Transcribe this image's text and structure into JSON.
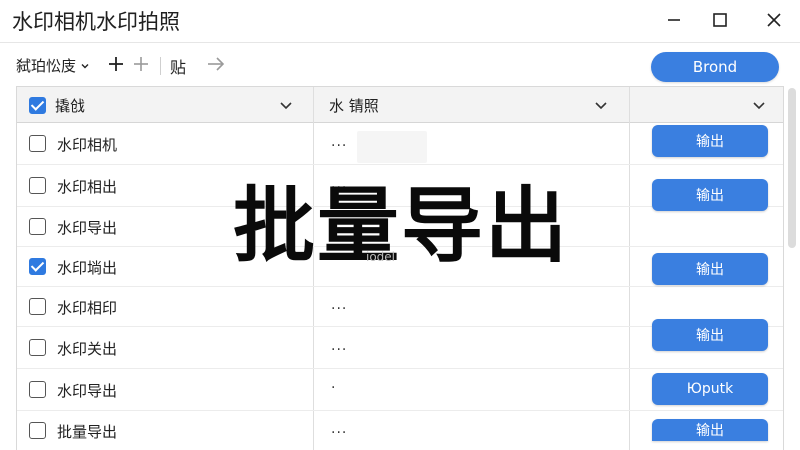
{
  "window": {
    "title": "水印相机水印拍照"
  },
  "toolbar": {
    "view_label": "弑珀忪庋",
    "paste_label": "贴",
    "brand_button": "Brond"
  },
  "table": {
    "header": {
      "col1": "撬戗",
      "col2": "水 锖照"
    },
    "rows": [
      {
        "name": "水印相机",
        "checked": false,
        "detail": "...",
        "export": "输出"
      },
      {
        "name": "水印相出",
        "checked": false,
        "detail": "...",
        "export": "输出"
      },
      {
        "name": "水印导出",
        "checked": false,
        "detail": "",
        "export": ""
      },
      {
        "name": "水印埫出",
        "checked": true,
        "detail": "",
        "export": "输出"
      },
      {
        "name": "水印相印",
        "checked": false,
        "detail": "...",
        "export": ""
      },
      {
        "name": "水印关出",
        "checked": false,
        "detail": "...",
        "export": "输出"
      },
      {
        "name": "水印导出",
        "checked": false,
        "detail": "·",
        "export": "Юputk"
      },
      {
        "name": "批量导出",
        "checked": false,
        "detail": "...",
        "export": "输出"
      }
    ]
  },
  "overlay": {
    "text": "批量导出",
    "ghost": "iodel"
  },
  "colors": {
    "accent": "#3a7fe0",
    "header_bg": "#f3f3f3"
  }
}
